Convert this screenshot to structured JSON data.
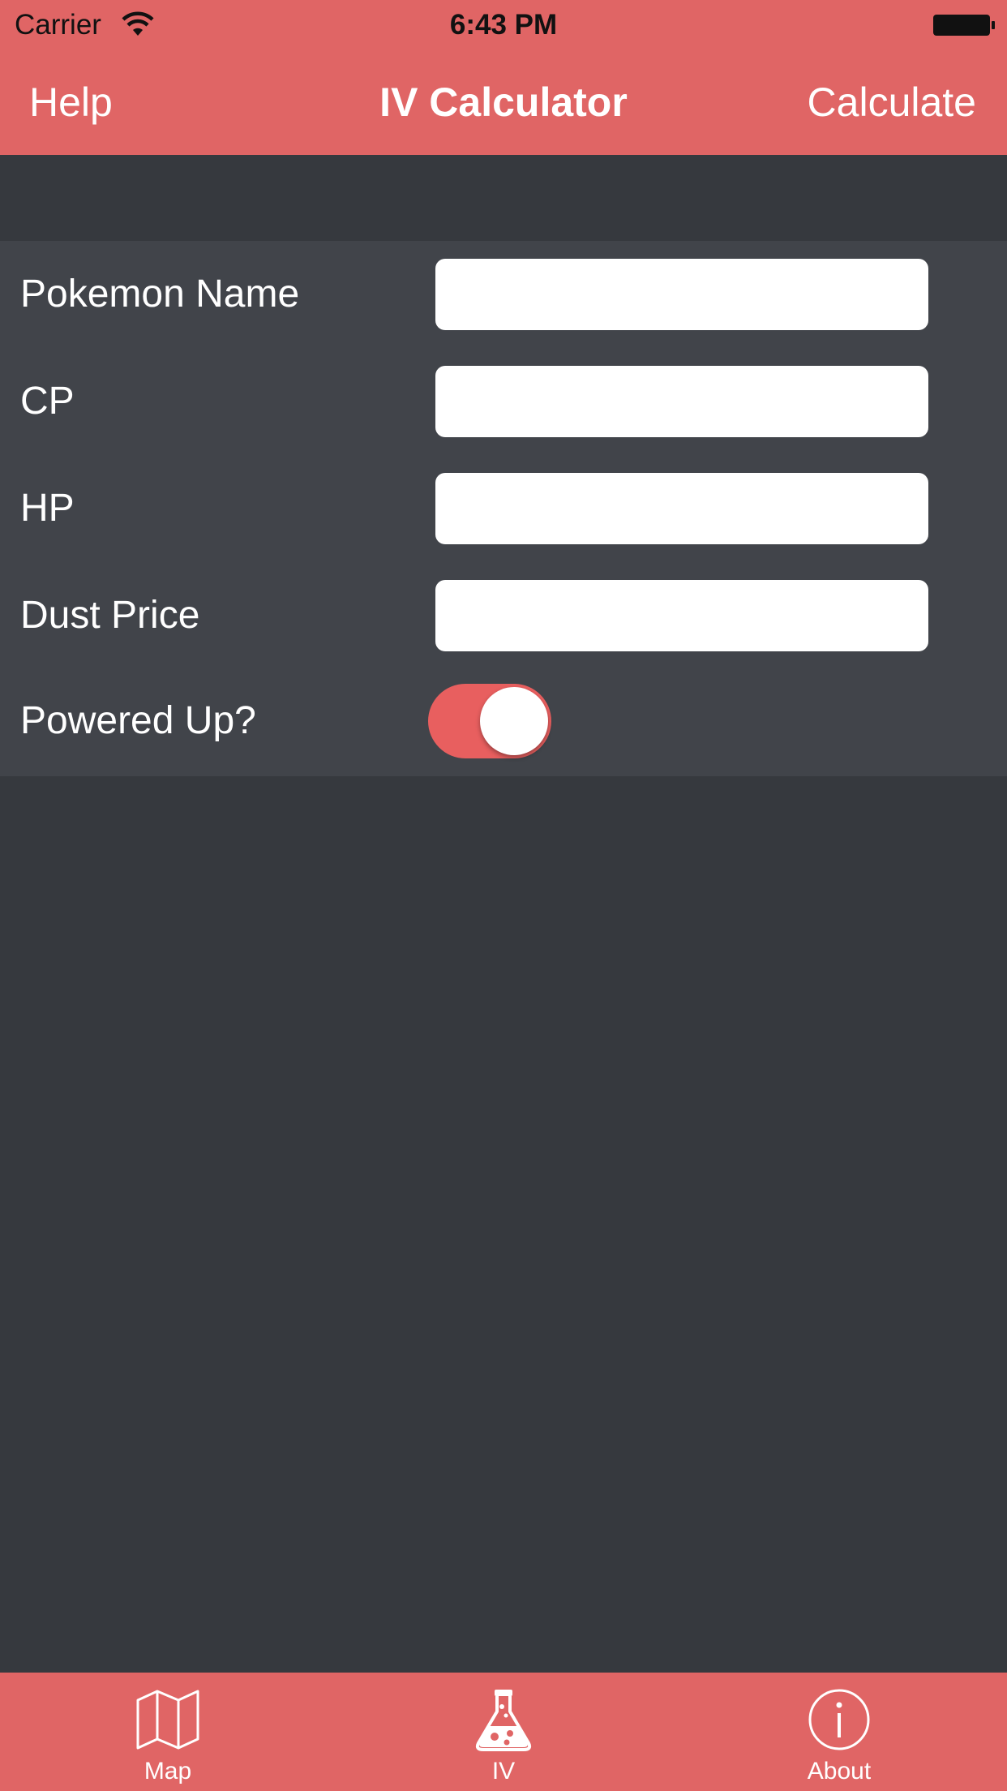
{
  "status_bar": {
    "carrier": "Carrier",
    "time": "6:43 PM"
  },
  "nav": {
    "left_button": "Help",
    "title": "IV Calculator",
    "right_button": "Calculate"
  },
  "form": {
    "fields": [
      {
        "label": "Pokemon Name",
        "value": "",
        "placeholder": ""
      },
      {
        "label": "CP",
        "value": "",
        "placeholder": ""
      },
      {
        "label": "HP",
        "value": "",
        "placeholder": ""
      },
      {
        "label": "Dust Price",
        "value": "",
        "placeholder": ""
      }
    ],
    "toggle": {
      "label": "Powered Up?",
      "on": true
    }
  },
  "tabs": [
    {
      "label": "Map",
      "icon": "map-icon"
    },
    {
      "label": "IV",
      "icon": "flask-icon",
      "selected": true
    },
    {
      "label": "About",
      "icon": "info-icon"
    }
  ],
  "colors": {
    "accent": "#e06565",
    "background": "#36393e",
    "form_background": "#41444a",
    "toggle_on": "#e85f5f"
  }
}
